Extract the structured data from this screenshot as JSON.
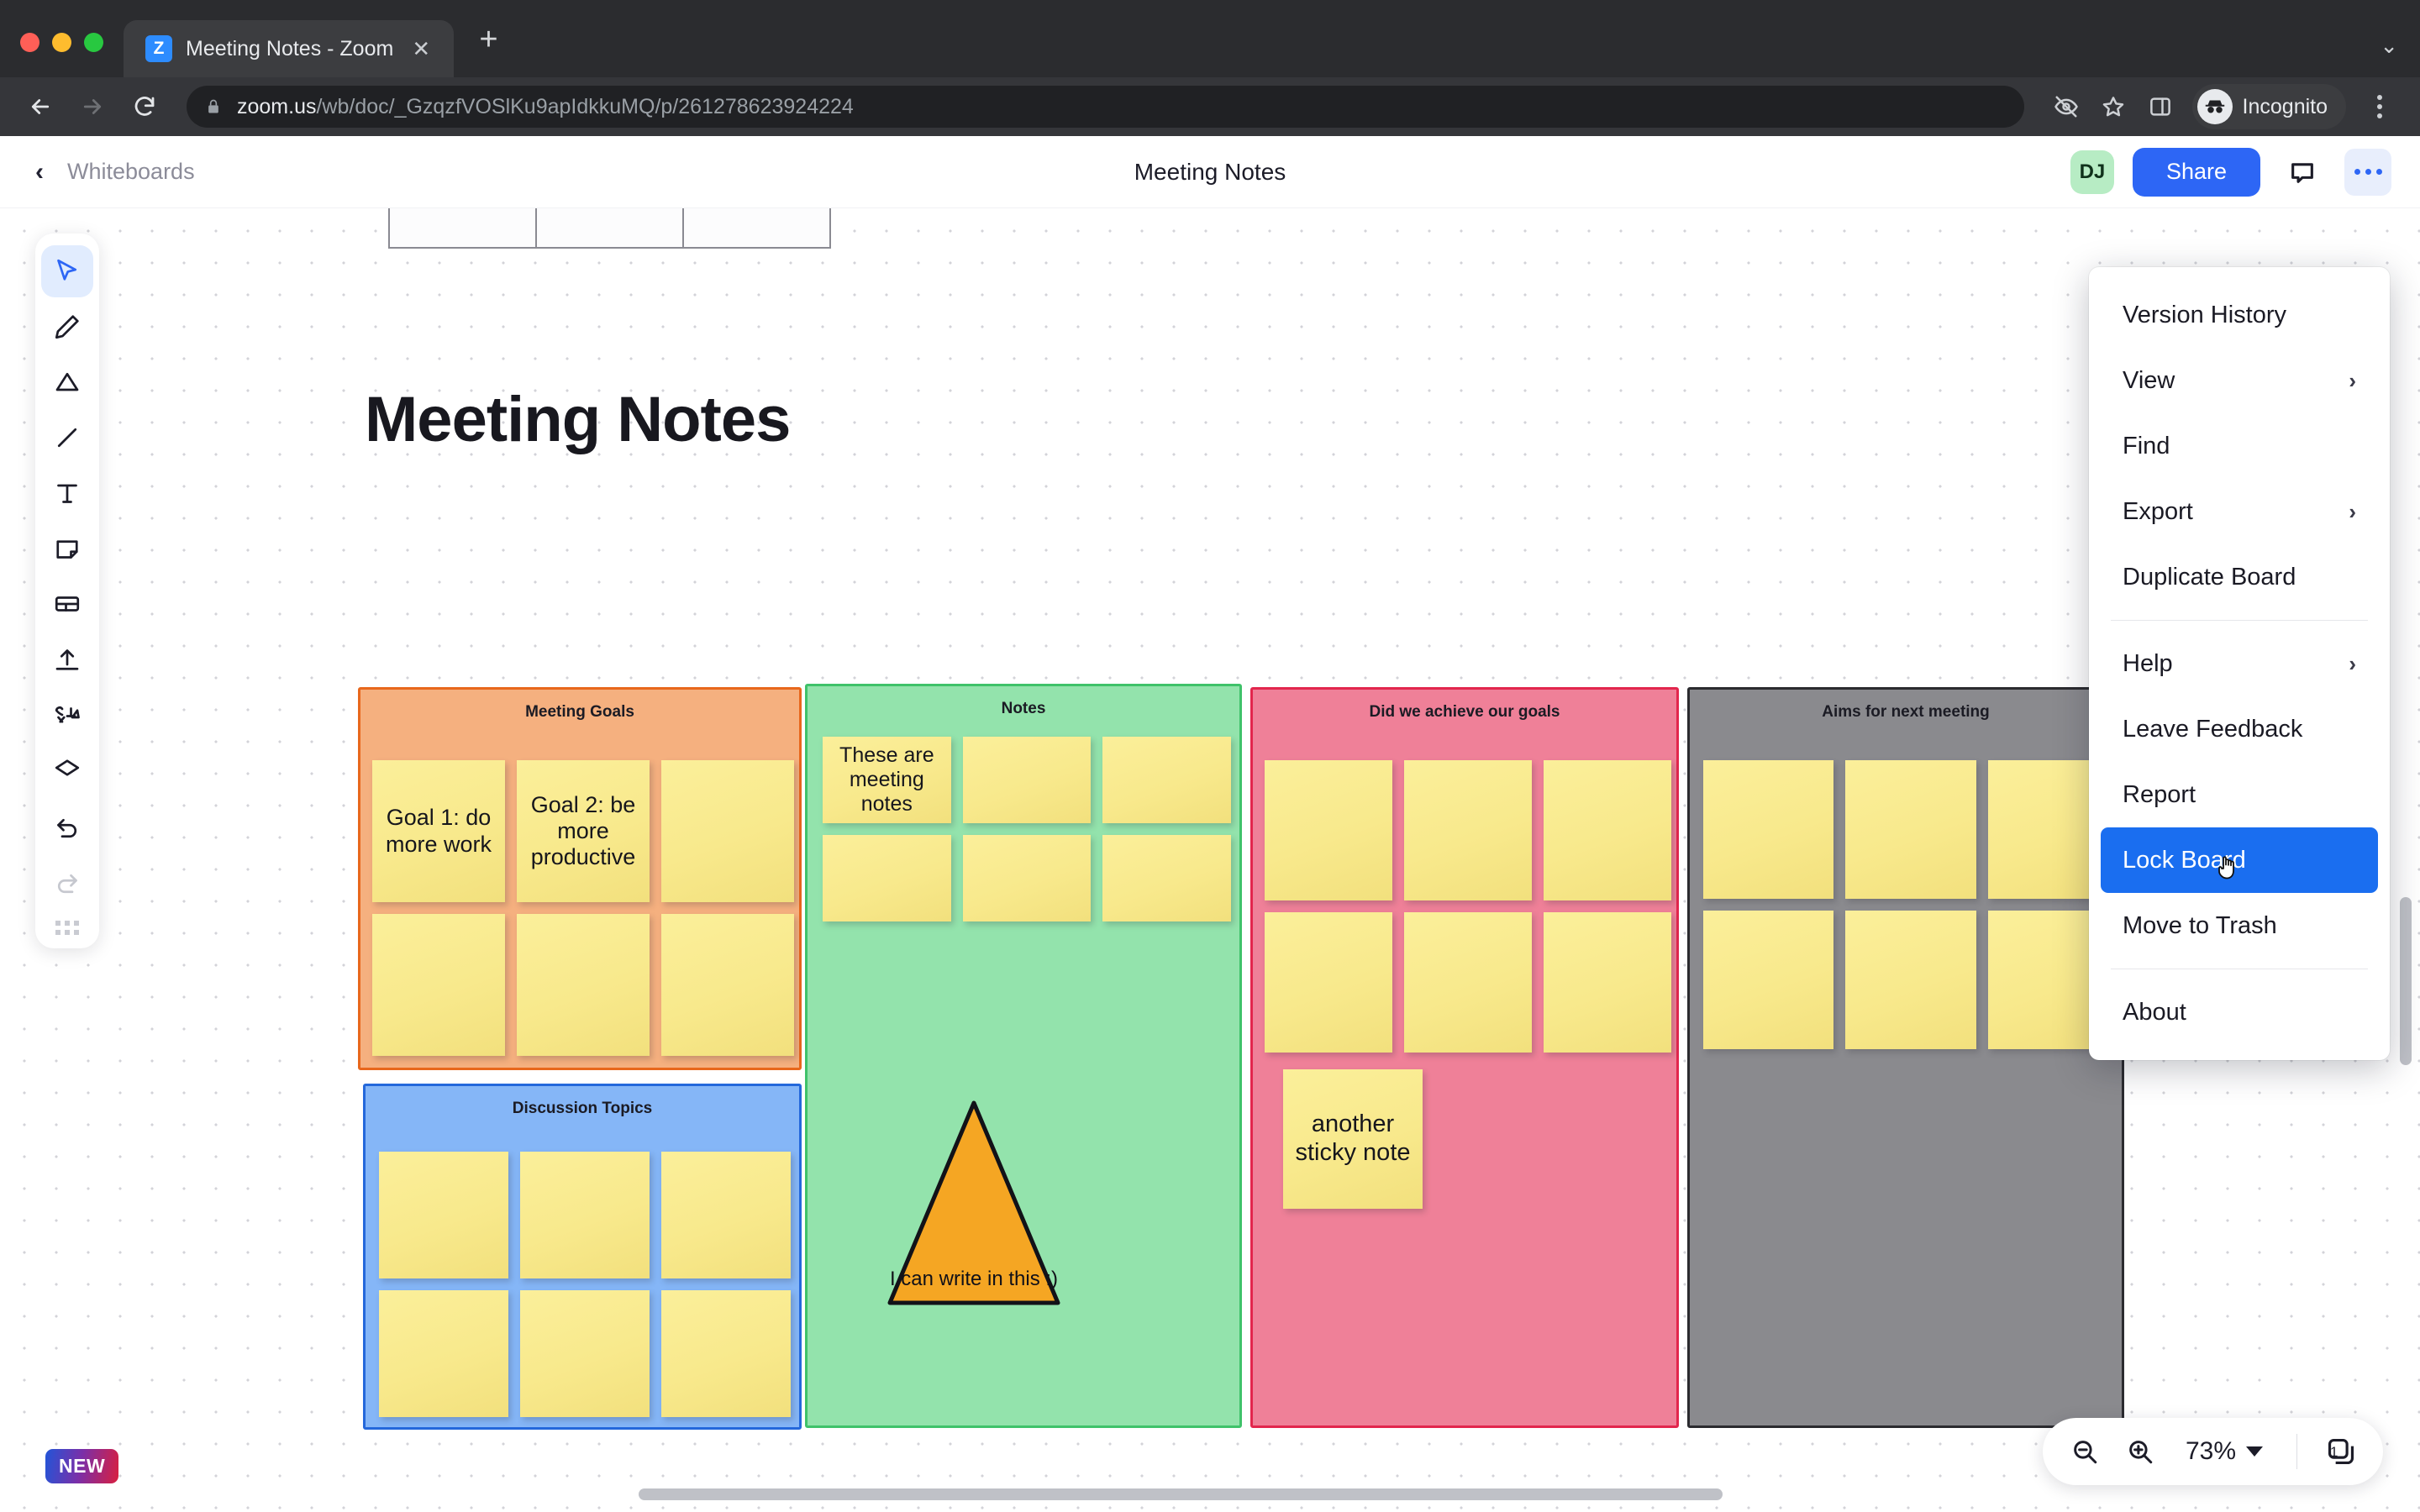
{
  "browser": {
    "tab": {
      "title": "Meeting Notes - Zoom",
      "favicon_letter": "Z",
      "close_icon": "close-icon"
    },
    "new_tab_glyph": "+",
    "tabstrip_caret": "⌄",
    "url": {
      "host": "zoom.us",
      "path": "/wb/doc/_GzqzfVOSlKu9apIdkkuMQ/p/261278623924224"
    },
    "profile_label": "Incognito",
    "nav": {
      "back": "back-arrow",
      "forward": "forward-arrow",
      "reload": "reload-icon"
    },
    "actions": [
      "eye-off-icon",
      "star-icon",
      "side-panel-icon"
    ]
  },
  "app": {
    "breadcrumb": "Whiteboards",
    "doc_title": "Meeting Notes",
    "avatar_initials": "DJ",
    "share_label": "Share",
    "comment_icon": "comment-icon",
    "more_icon": "more-options-icon",
    "accent_color": "#2d66f5"
  },
  "toolbar": {
    "tools": [
      {
        "name": "select-tool",
        "label": "Select",
        "active": true
      },
      {
        "name": "pen-tool",
        "label": "Pen",
        "active": false
      },
      {
        "name": "shape-tool",
        "label": "Shape",
        "active": false
      },
      {
        "name": "line-tool",
        "label": "Line",
        "active": false
      },
      {
        "name": "text-tool",
        "label": "Text",
        "active": false
      },
      {
        "name": "sticky-note-tool",
        "label": "Sticky Note",
        "active": false
      },
      {
        "name": "frame-tool",
        "label": "Frame",
        "active": false
      },
      {
        "name": "upload-tool",
        "label": "Upload",
        "active": false
      },
      {
        "name": "sticker-tool",
        "label": "Sticker",
        "active": false
      },
      {
        "name": "eraser-tool",
        "label": "Eraser",
        "active": false
      },
      {
        "name": "undo-tool",
        "label": "Undo",
        "active": false
      },
      {
        "name": "redo-tool",
        "label": "Redo",
        "active": false,
        "disabled": true
      }
    ]
  },
  "board": {
    "heading": "Meeting Notes",
    "frames": [
      {
        "id": "meeting-goals",
        "title": "Meeting Goals",
        "fill": "#f5b07f",
        "border": "#e8671c",
        "notes": [
          "Goal 1: do more work",
          "Goal 2: be more productive",
          "",
          "",
          "",
          ""
        ]
      },
      {
        "id": "notes",
        "title": "Notes",
        "fill": "#93e3ac",
        "border": "#3fc26a",
        "notes": [
          "These are meeting notes",
          "",
          "",
          "",
          "",
          ""
        ],
        "shape": {
          "type": "triangle",
          "fill": "#f5a623",
          "text": "I can write in this :)"
        }
      },
      {
        "id": "did-we-achieve-our-goals",
        "title": "Did we achieve our goals",
        "fill": "#ef8098",
        "border": "#e2264d",
        "notes": [
          "",
          "",
          "",
          "",
          "",
          ""
        ],
        "extra_note": "another sticky note"
      },
      {
        "id": "aims-for-next-meeting",
        "title": "Aims for next meeting",
        "fill": "#8a8a8e",
        "border": "#2b2b2f",
        "notes": [
          "",
          "",
          "",
          "",
          "",
          ""
        ]
      },
      {
        "id": "discussion-topics",
        "title": "Discussion Topics",
        "fill": "#85b6f7",
        "border": "#2468db",
        "notes": [
          "",
          "",
          "",
          "",
          "",
          ""
        ]
      }
    ]
  },
  "menu": {
    "items": [
      {
        "label": "Version History",
        "submenu": false,
        "highlight": false
      },
      {
        "label": "View",
        "submenu": true,
        "highlight": false
      },
      {
        "label": "Find",
        "submenu": false,
        "highlight": false
      },
      {
        "label": "Export",
        "submenu": true,
        "highlight": false
      },
      {
        "label": "Duplicate Board",
        "submenu": false,
        "highlight": false,
        "divider_after": true
      },
      {
        "label": "Help",
        "submenu": true,
        "highlight": false
      },
      {
        "label": "Leave Feedback",
        "submenu": false,
        "highlight": false
      },
      {
        "label": "Report",
        "submenu": false,
        "highlight": false
      },
      {
        "label": "Lock Board",
        "submenu": false,
        "highlight": true
      },
      {
        "label": "Move to Trash",
        "submenu": false,
        "highlight": false,
        "divider_after": true
      },
      {
        "label": "About",
        "submenu": false,
        "highlight": false
      }
    ],
    "submenu_glyph": "›",
    "highlight_color": "#1a6ef0"
  },
  "footer": {
    "new_badge": "NEW",
    "zoom_level": "73%",
    "zoom_out_icon": "zoom-out-icon",
    "zoom_in_icon": "zoom-in-icon",
    "pages_count": "1",
    "pages_icon": "pages-icon"
  }
}
